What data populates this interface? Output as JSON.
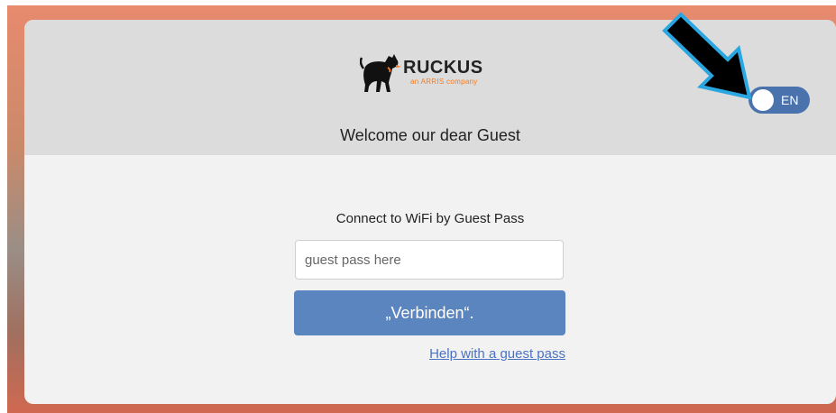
{
  "brand": {
    "logo_name": "RUCKUS",
    "logo_sub": "an ARRIS company"
  },
  "header": {
    "welcome": "Welcome our dear Guest"
  },
  "language_toggle": {
    "label": "EN",
    "color": "#4a72ad"
  },
  "form": {
    "title": "Connect to WiFi by Guest Pass",
    "input_placeholder": "guest pass here",
    "input_value": "",
    "connect_label": "„Verbinden“.",
    "help_link": "Help with a guest pass"
  },
  "colors": {
    "button": "#5b85bf",
    "header_bg": "#dcdcdc",
    "card_bg": "#f2f2f2",
    "arrow": "#000000",
    "arrow_outline": "#2aa6e0"
  },
  "icons": {
    "logo": "dog-icon",
    "annotation": "arrow-icon"
  }
}
